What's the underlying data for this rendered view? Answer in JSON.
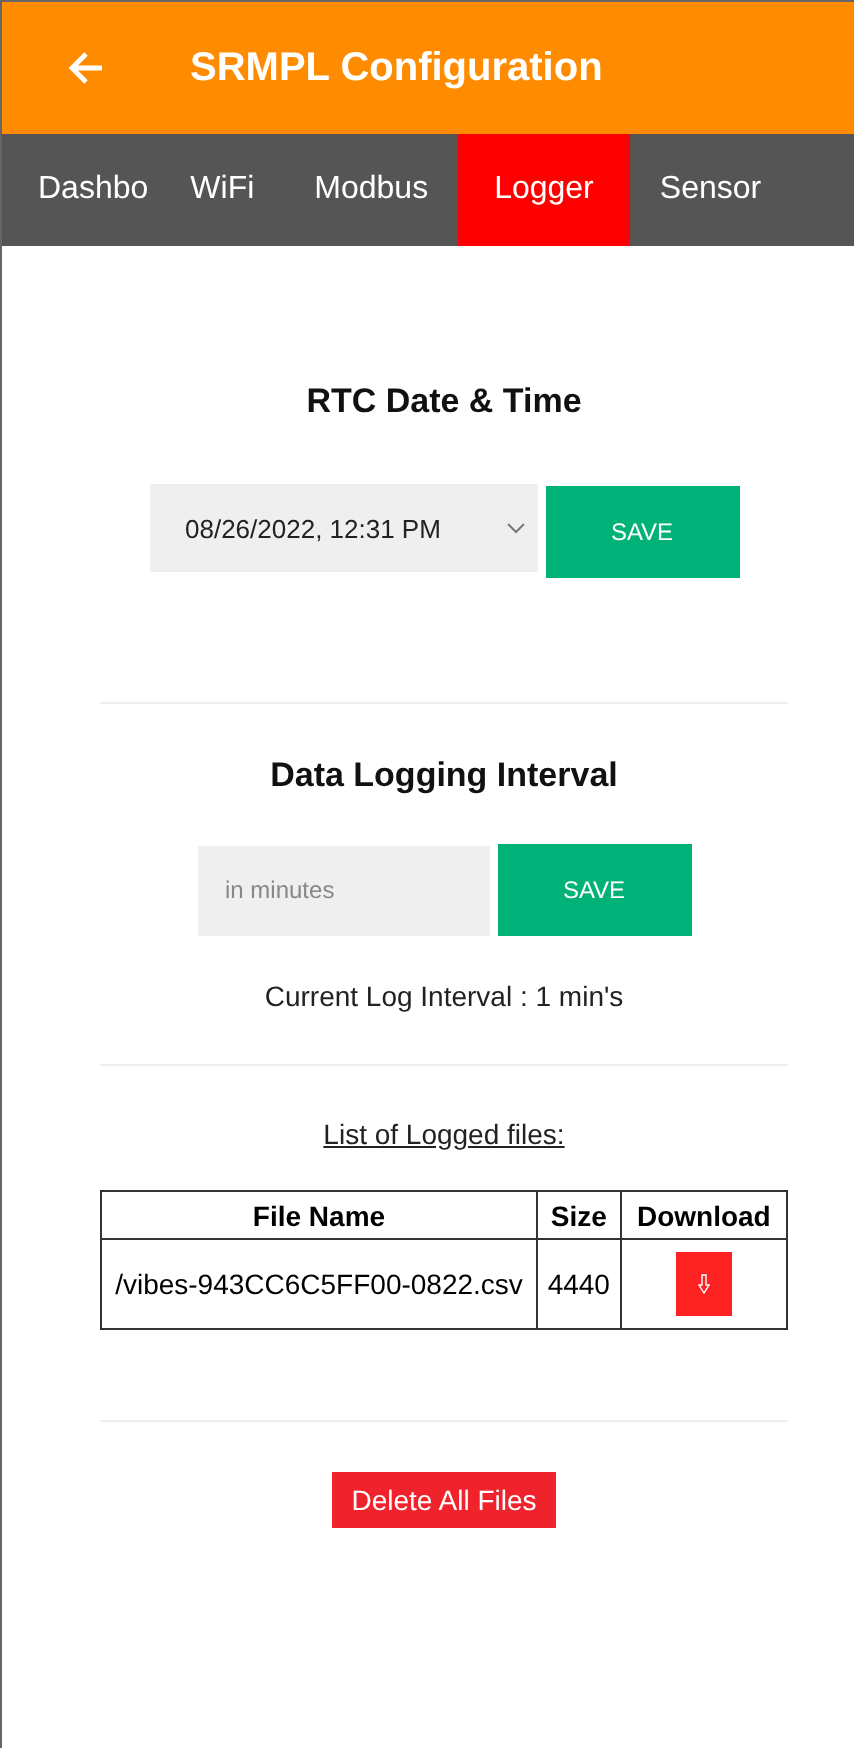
{
  "app_bar": {
    "title": "SRMPL Configuration"
  },
  "tabs": [
    {
      "label": "Dashbo",
      "selected": false
    },
    {
      "label": "WiFi",
      "selected": false
    },
    {
      "label": "Modbus",
      "selected": false
    },
    {
      "label": "Logger",
      "selected": true
    },
    {
      "label": "Sensor",
      "selected": false
    }
  ],
  "rtc": {
    "heading": "RTC Date & Time",
    "value": "08/26/2022, 12:31 PM",
    "button": "SAVE"
  },
  "interval": {
    "heading": "Data Logging Interval",
    "placeholder": "in minutes",
    "button": "SAVE",
    "current": "Current Log Interval : 1 min's"
  },
  "files": {
    "heading": "List of Logged files:",
    "columns": [
      "File Name",
      "Size",
      "Download"
    ],
    "rows": [
      {
        "name": "/vibes-943CC6C5FF00-0822.csv",
        "size": "4440"
      }
    ],
    "delete_button": "Delete All Files"
  }
}
